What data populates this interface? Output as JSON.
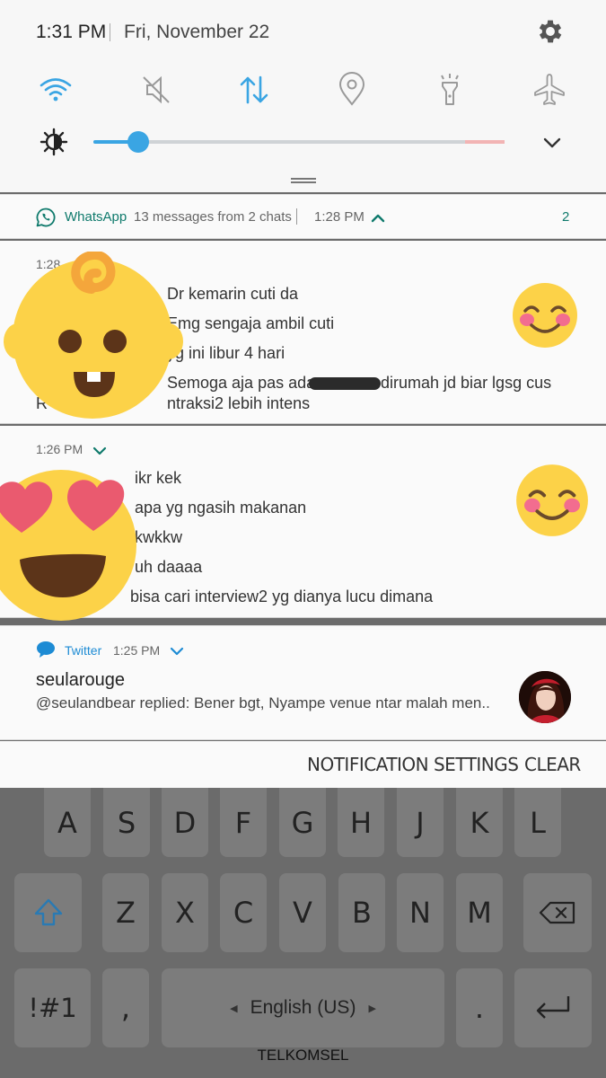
{
  "status": {
    "time": "1:31 PM",
    "date": "Fri, November 22"
  },
  "quick_panel": {
    "toggles": [
      {
        "name": "wifi-icon",
        "active": true
      },
      {
        "name": "mute-icon",
        "active": false
      },
      {
        "name": "data-transfer-icon",
        "active": true
      },
      {
        "name": "location-icon",
        "active": false
      },
      {
        "name": "flashlight-icon",
        "active": false
      },
      {
        "name": "airplane-icon",
        "active": false
      }
    ],
    "brightness": 0.11
  },
  "whatsapp": {
    "app_name": "WhatsApp",
    "summary": "13 messages from 2 chats",
    "time": "1:28 PM",
    "count": "2",
    "chat1": {
      "time": "1:28",
      "lines": [
        "Dr kemarin cuti da",
        "Emg sengaja ambil cuti",
        "yg ini libur 4 hari",
        "Semoga aja pas ada",
        "dirumah jd biar lgsg cus",
        "ntraksi2 lebih intens"
      ],
      "line4_prefix": "R"
    },
    "chat2": {
      "time": "1:26 PM",
      "lines": [
        "ikr kek",
        "apa yg ngasih makanan",
        "kwkkw",
        "uh daaaa",
        "bisa cari interview2 yg dianya lucu dimana"
      ]
    }
  },
  "twitter": {
    "app_name": "Twitter",
    "time": "1:25 PM",
    "title": "seularouge",
    "body": "@seulandbear replied: Bener bgt, Nyampe venue ntar malah men.."
  },
  "actions": {
    "settings": "NOTIFICATION SETTINGS",
    "clear": "CLEAR"
  },
  "keyboard": {
    "row1": [
      "A",
      "S",
      "D",
      "F",
      "G",
      "H",
      "J",
      "K",
      "L"
    ],
    "row2": [
      "Z",
      "X",
      "C",
      "V",
      "B",
      "N",
      "M"
    ],
    "sym": "!#1",
    "comma": ",",
    "space": "English (US)",
    "period": "."
  },
  "carrier": "TELKOMSEL",
  "colors": {
    "accent": "#3aa5e3",
    "whatsapp": "#0f7a6c",
    "twitter": "#1d8bd4"
  }
}
